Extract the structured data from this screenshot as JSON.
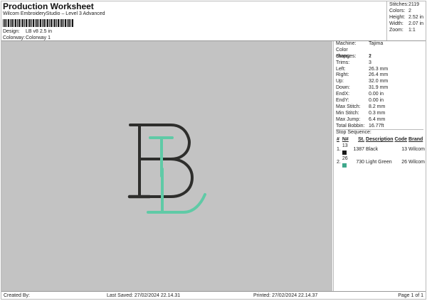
{
  "header": {
    "title": "Production Worksheet",
    "subtitle": "Wilcom EmbroideryStudio – Level 3 Advanced",
    "design_label": "Design:",
    "design_value": "LB v8 2.5 in",
    "colorway_label": "Colorway:",
    "colorway_value": "Colorway 1"
  },
  "stats": [
    {
      "k": "Stitches:",
      "v": "2119"
    },
    {
      "k": "Colors:",
      "v": "2"
    },
    {
      "k": "Height:",
      "v": "2.52 in"
    },
    {
      "k": "Width:",
      "v": "2.07 in"
    },
    {
      "k": "Zoom:",
      "v": "1:1"
    }
  ],
  "details": [
    {
      "k": "Machine:",
      "v": "Tajima"
    },
    {
      "k": "Color changes:",
      "v": "1"
    },
    {
      "k": "Stops:",
      "v": "2"
    },
    {
      "k": "Trims:",
      "v": "3"
    },
    {
      "k": "Left:",
      "v": "26.3 mm"
    },
    {
      "k": "Right:",
      "v": "26.4 mm"
    },
    {
      "k": "Up:",
      "v": "32.0 mm"
    },
    {
      "k": "Down:",
      "v": "31.9 mm"
    },
    {
      "k": "EndX:",
      "v": "0.00 in"
    },
    {
      "k": "EndY:",
      "v": "0.00 in"
    },
    {
      "k": "Max Stitch:",
      "v": "8.2 mm"
    },
    {
      "k": "Min Stitch:",
      "v": "0.3 mm"
    },
    {
      "k": "Max Jump:",
      "v": "6.4 mm"
    },
    {
      "k": "Total Bobbin:",
      "v": "16.77ft"
    }
  ],
  "stop_sequence": {
    "label": "Stop Sequence:",
    "headers": [
      "#",
      "N#",
      "St.",
      "Description",
      "Code",
      "Brand"
    ],
    "rows": [
      {
        "n": "1.",
        "needle": "13",
        "color": "#1a1a1a",
        "st": "1387",
        "desc": "Black",
        "code": "13",
        "brand": "Wilcom"
      },
      {
        "n": "2.",
        "needle": "26",
        "color": "#3fa88c",
        "st": "730",
        "desc": "Light Green",
        "code": "26",
        "brand": "Wilcom"
      }
    ]
  },
  "design_colors": {
    "black": "#2e2e2c",
    "green": "#5fcaa6",
    "canvas": "#c3c3c3"
  },
  "footer": {
    "created": "Created By:",
    "saved": "Last Saved: 27/02/2024 22.14.31",
    "printed": "Printed: 27/02/2024 22.14.37",
    "page": "Page 1 of 1"
  }
}
